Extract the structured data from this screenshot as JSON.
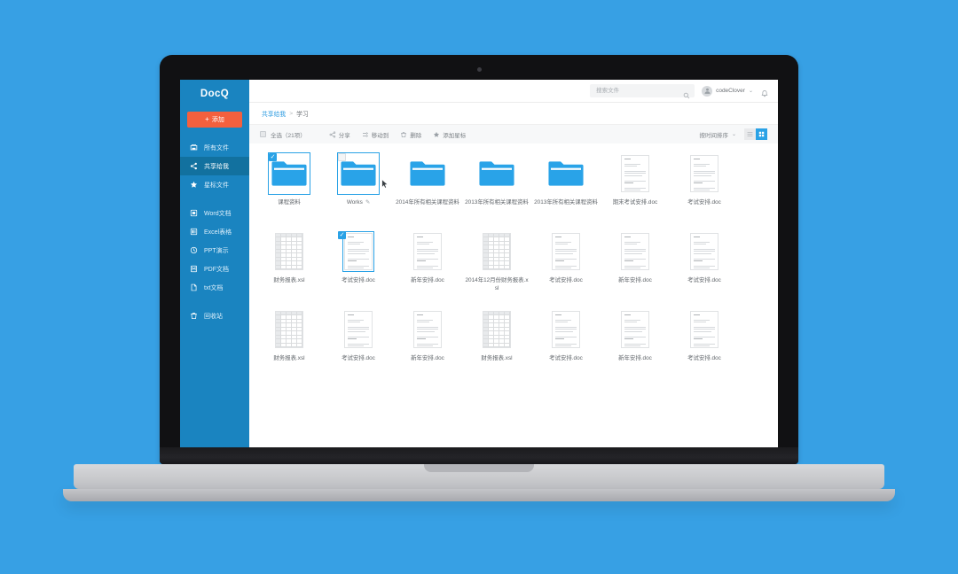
{
  "theme": {
    "page_background": "#37a0e4",
    "sidebar_background": "#1a84c0",
    "sidebar_active": "#12719f",
    "accent_orange": "#f4603e",
    "accent_blue": "#2aa2e6"
  },
  "sidebar": {
    "brand": "DocQ",
    "add_button": {
      "label": "添加",
      "plus": "+"
    },
    "groups": [
      {
        "items": [
          {
            "label": "所有文件",
            "icon": "all-files-icon",
            "active": false
          },
          {
            "label": "共享给我",
            "icon": "share-icon",
            "active": true
          },
          {
            "label": "星标文件",
            "icon": "star-icon",
            "active": false
          }
        ]
      },
      {
        "items": [
          {
            "label": "Word文档",
            "icon": "word-doc-icon",
            "active": false
          },
          {
            "label": "Excel表格",
            "icon": "excel-sheet-icon",
            "active": false
          },
          {
            "label": "PPT演示",
            "icon": "ppt-icon",
            "active": false
          },
          {
            "label": "PDF文档",
            "icon": "pdf-icon",
            "active": false
          },
          {
            "label": "txt文档",
            "icon": "txt-icon",
            "active": false
          }
        ]
      },
      {
        "items": [
          {
            "label": "回收站",
            "icon": "trash-icon",
            "active": false
          }
        ]
      }
    ]
  },
  "topbar": {
    "search": {
      "placeholder": "搜索文件",
      "value": "",
      "icon": "search-icon"
    },
    "user": {
      "name": "codeClover",
      "caret": "⌄",
      "avatar_icon": "avatar-icon"
    },
    "notification_icon": "bell-icon"
  },
  "breadcrumb": {
    "root": "共享给我",
    "separator": ">",
    "current": "学习"
  },
  "toolbar": {
    "select_all_label": "全选（21项）",
    "actions": [
      {
        "label": "分享",
        "icon": "share-icon"
      },
      {
        "label": "移动到",
        "icon": "move-icon"
      },
      {
        "label": "删除",
        "icon": "trash-icon"
      },
      {
        "label": "添加星标",
        "icon": "star-icon"
      }
    ],
    "sort_label": "按时间排序",
    "sort_caret": "⌄",
    "view_list_icon": "list-view-icon",
    "view_grid_icon": "grid-view-icon",
    "active_view": "grid"
  },
  "files": [
    {
      "name": "课程资料",
      "type": "folder",
      "selected": true,
      "checkbox": "checked",
      "hover": false,
      "renamable": false
    },
    {
      "name": "Works",
      "type": "folder",
      "selected": true,
      "checkbox": "empty",
      "hover": true,
      "renamable": true,
      "pencil": "✎"
    },
    {
      "name": "2014年所有相关课程资料",
      "type": "folder",
      "selected": false,
      "checkbox": "none",
      "hover": false,
      "renamable": false
    },
    {
      "name": "2013年所有相关课程资料",
      "type": "folder",
      "selected": false,
      "checkbox": "none",
      "hover": false,
      "renamable": false
    },
    {
      "name": "2013年所有相关课程资料",
      "type": "folder",
      "selected": false,
      "checkbox": "none",
      "hover": false,
      "renamable": false
    },
    {
      "name": "期末考试安排.doc",
      "type": "doc",
      "selected": false,
      "checkbox": "none",
      "hover": false,
      "renamable": false
    },
    {
      "name": "考试安排.doc",
      "type": "doc",
      "selected": false,
      "checkbox": "none",
      "hover": false,
      "renamable": false
    },
    {
      "name": "财务报表.xsl",
      "type": "sheet",
      "selected": false,
      "checkbox": "none",
      "hover": false,
      "renamable": false
    },
    {
      "name": "考试安排.doc",
      "type": "doc",
      "selected": true,
      "checkbox": "checked",
      "hover": false,
      "renamable": false
    },
    {
      "name": "新年安排.doc",
      "type": "doc",
      "selected": false,
      "checkbox": "none",
      "hover": false,
      "renamable": false
    },
    {
      "name": "2014年12月份财务报表.xsl",
      "type": "sheet",
      "selected": false,
      "checkbox": "none",
      "hover": false,
      "renamable": false
    },
    {
      "name": "考试安排.doc",
      "type": "doc",
      "selected": false,
      "checkbox": "none",
      "hover": false,
      "renamable": false
    },
    {
      "name": "新年安排.doc",
      "type": "doc",
      "selected": false,
      "checkbox": "none",
      "hover": false,
      "renamable": false
    },
    {
      "name": "考试安排.doc",
      "type": "doc",
      "selected": false,
      "checkbox": "none",
      "hover": false,
      "renamable": false
    },
    {
      "name": "财务报表.xsl",
      "type": "sheet",
      "selected": false,
      "checkbox": "none",
      "hover": false,
      "renamable": false
    },
    {
      "name": "考试安排.doc",
      "type": "doc",
      "selected": false,
      "checkbox": "none",
      "hover": false,
      "renamable": false
    },
    {
      "name": "新年安排.doc",
      "type": "doc",
      "selected": false,
      "checkbox": "none",
      "hover": false,
      "renamable": false
    },
    {
      "name": "财务报表.xsl",
      "type": "sheet",
      "selected": false,
      "checkbox": "none",
      "hover": false,
      "renamable": false
    },
    {
      "name": "考试安排.doc",
      "type": "doc",
      "selected": false,
      "checkbox": "none",
      "hover": false,
      "renamable": false
    },
    {
      "name": "新年安排.doc",
      "type": "doc",
      "selected": false,
      "checkbox": "none",
      "hover": false,
      "renamable": false
    },
    {
      "name": "考试安排.doc",
      "type": "doc",
      "selected": false,
      "checkbox": "none",
      "hover": false,
      "renamable": false
    }
  ]
}
